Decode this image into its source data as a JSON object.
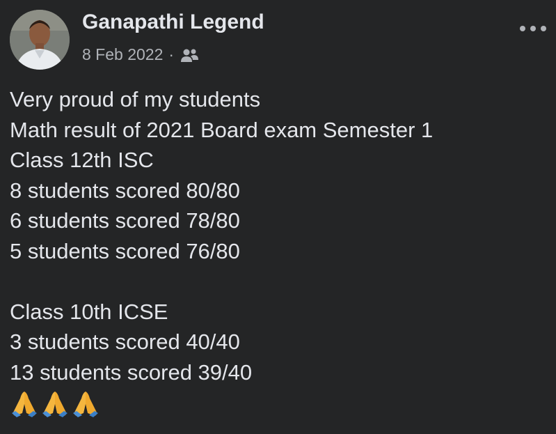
{
  "post": {
    "author": "Ganapathi Legend",
    "date": "8 Feb 2022",
    "separator": "·",
    "audience_icon": "friends-icon",
    "menu_icon": "more-options-icon",
    "lines": [
      "Very proud of my students",
      "Math result of 2021 Board exam Semester 1",
      "Class 12th ISC",
      "8 students scored 80/80",
      "6 students scored 78/80",
      "5 students scored 76/80",
      "",
      "Class 10th ICSE",
      "3 students scored 40/40",
      "13 students scored 39/40"
    ],
    "emojis": [
      "folded-hands-icon",
      "folded-hands-icon",
      "folded-hands-icon"
    ]
  },
  "colors": {
    "background": "#242526",
    "primary_text": "#e4e6eb",
    "secondary_text": "#b0b3b8",
    "emoji": "#f4b63f"
  }
}
